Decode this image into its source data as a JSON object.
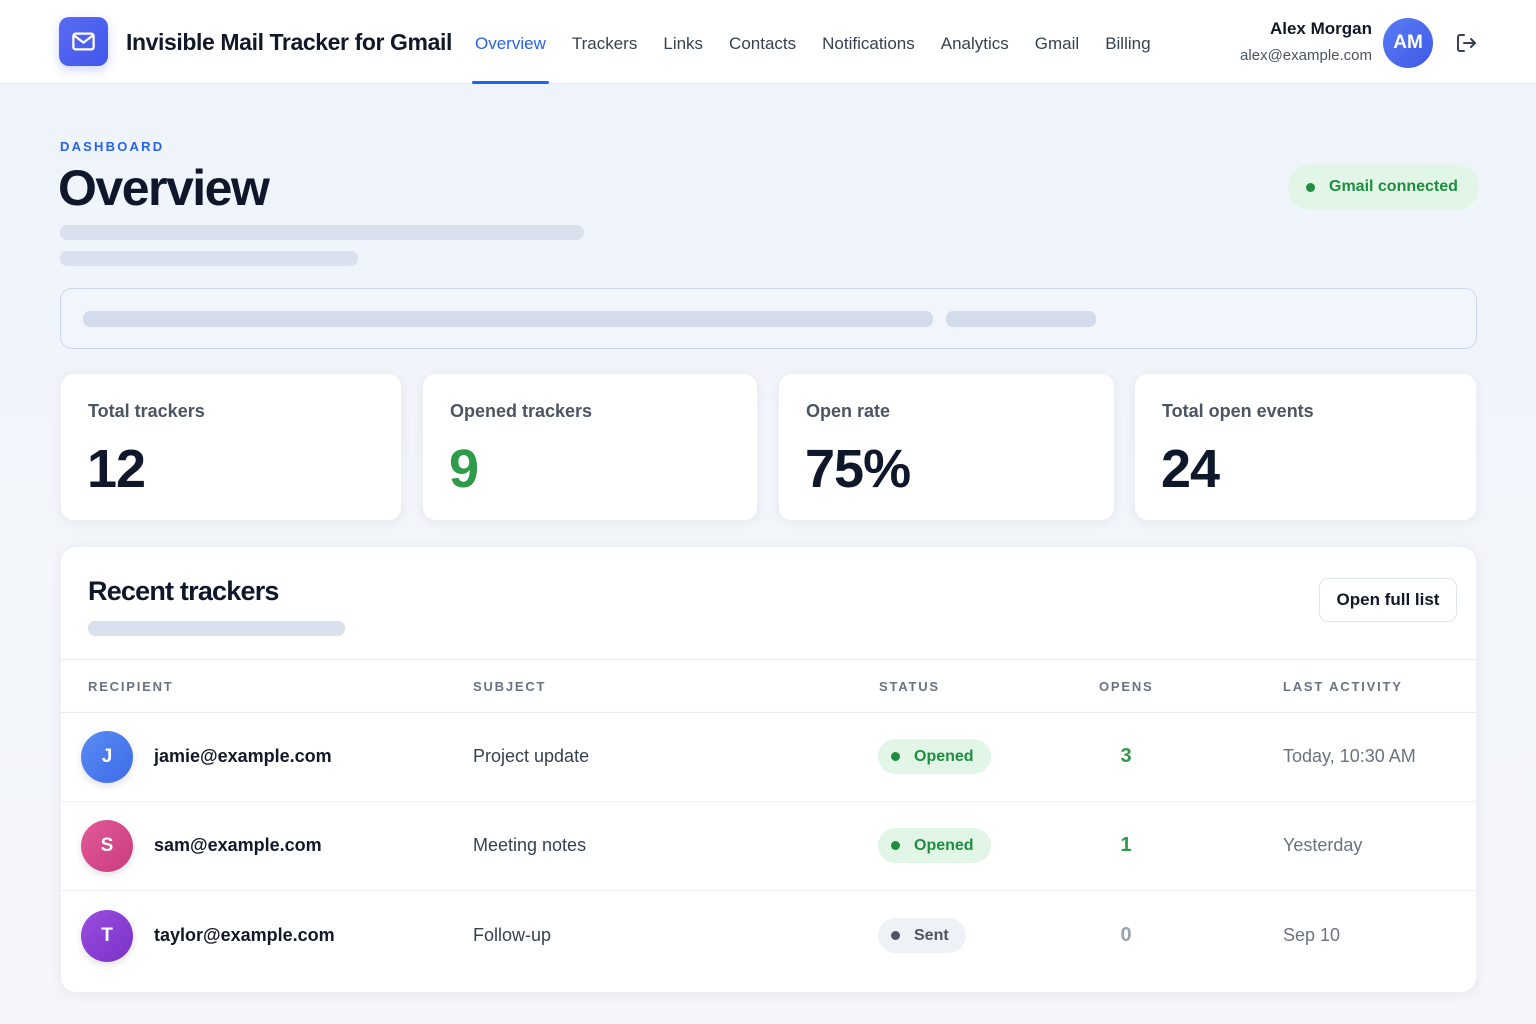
{
  "app": {
    "title": "Invisible Mail Tracker for Gmail",
    "logo_icon": "mail-icon",
    "accent": "#2563eb"
  },
  "nav": {
    "items": [
      {
        "label": "Overview",
        "active": true
      },
      {
        "label": "Trackers"
      },
      {
        "label": "Links"
      },
      {
        "label": "Contacts"
      },
      {
        "label": "Notifications"
      },
      {
        "label": "Analytics"
      },
      {
        "label": "Gmail"
      },
      {
        "label": "Billing"
      }
    ]
  },
  "user": {
    "name": "Alex Morgan",
    "email": "alex@example.com",
    "initials": "AM",
    "logout_icon": "logout-icon"
  },
  "header": {
    "eyebrow": "DASHBOARD",
    "title": "Overview",
    "status": "Gmail connected",
    "status_color": "#1e8e3e"
  },
  "stats": [
    {
      "label": "Total trackers",
      "value": "12"
    },
    {
      "label": "Opened trackers",
      "value": "9",
      "color": "#2f9a48"
    },
    {
      "label": "Open rate",
      "value": "75%"
    },
    {
      "label": "Total open events",
      "value": "24"
    }
  ],
  "recent": {
    "title": "Recent trackers",
    "open_button": "Open full list",
    "columns": [
      "RECIPIENT",
      "SUBJECT",
      "STATUS",
      "OPENS",
      "LAST ACTIVITY"
    ],
    "rows": [
      {
        "initial": "J",
        "avatar_color": "#4a7cf0",
        "recipient": "jamie@example.com",
        "subject": "Project update",
        "status": "Opened",
        "opens": "3",
        "last_activity": "Today, 10:30 AM"
      },
      {
        "initial": "S",
        "avatar_color": "#d94d8f",
        "recipient": "sam@example.com",
        "subject": "Meeting notes",
        "status": "Opened",
        "opens": "1",
        "last_activity": "Yesterday"
      },
      {
        "initial": "T",
        "avatar_color": "#8b3fd6",
        "recipient": "taylor@example.com",
        "subject": "Follow-up",
        "status": "Sent",
        "opens": "0",
        "last_activity": "Sep 10"
      }
    ]
  }
}
